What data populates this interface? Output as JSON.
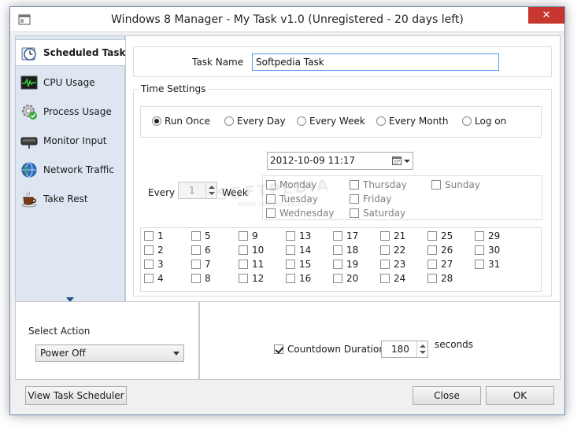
{
  "window": {
    "title": "Windows 8 Manager - My Task v1.0 (Unregistered - 20 days left)",
    "close_glyph": "✕"
  },
  "sidebar": {
    "items": [
      {
        "label": "Scheduled Task",
        "icon": "scheduled-task-icon",
        "active": true
      },
      {
        "label": "CPU Usage",
        "icon": "cpu-usage-icon",
        "active": false
      },
      {
        "label": "Process Usage",
        "icon": "process-usage-icon",
        "active": false
      },
      {
        "label": "Monitor Input",
        "icon": "monitor-input-icon",
        "active": false
      },
      {
        "label": "Network Traffic",
        "icon": "network-traffic-icon",
        "active": false
      },
      {
        "label": "Take Rest",
        "icon": "take-rest-icon",
        "active": false
      }
    ]
  },
  "task": {
    "name_label": "Task Name",
    "name_value": "Softpedia Task"
  },
  "time_settings": {
    "legend": "Time Settings",
    "radios": [
      {
        "label": "Run Once",
        "checked": true
      },
      {
        "label": "Every Day",
        "checked": false
      },
      {
        "label": "Every Week",
        "checked": false
      },
      {
        "label": "Every Month",
        "checked": false
      },
      {
        "label": "Log on",
        "checked": false
      }
    ],
    "datetime": "2012-10-09 11:17",
    "every_label": "Every",
    "every_value": "1",
    "week_label": "Week",
    "weekdays": [
      "Monday",
      "Tuesday",
      "Wednesday",
      "Thursday",
      "Friday",
      "Saturday",
      "Sunday"
    ],
    "month_days": [
      "1",
      "2",
      "3",
      "4",
      "5",
      "6",
      "7",
      "8",
      "9",
      "10",
      "11",
      "12",
      "13",
      "14",
      "15",
      "16",
      "17",
      "18",
      "19",
      "20",
      "21",
      "22",
      "23",
      "24",
      "25",
      "26",
      "27",
      "28",
      "29",
      "30",
      "31"
    ]
  },
  "action": {
    "label": "Select Action",
    "value": "Power Off"
  },
  "countdown": {
    "label": "Countdown Duration",
    "checked": true,
    "value": "180",
    "unit": "seconds"
  },
  "buttons": {
    "view_scheduler": "View Task Scheduler",
    "close": "Close",
    "ok": "OK"
  },
  "watermark": {
    "text": "SOFTPEDIA",
    "url": "www.softpedia.com"
  },
  "colors": {
    "accent": "#569de5",
    "sidebar_bg": "#dde6f1",
    "close_red": "#c7372f"
  }
}
